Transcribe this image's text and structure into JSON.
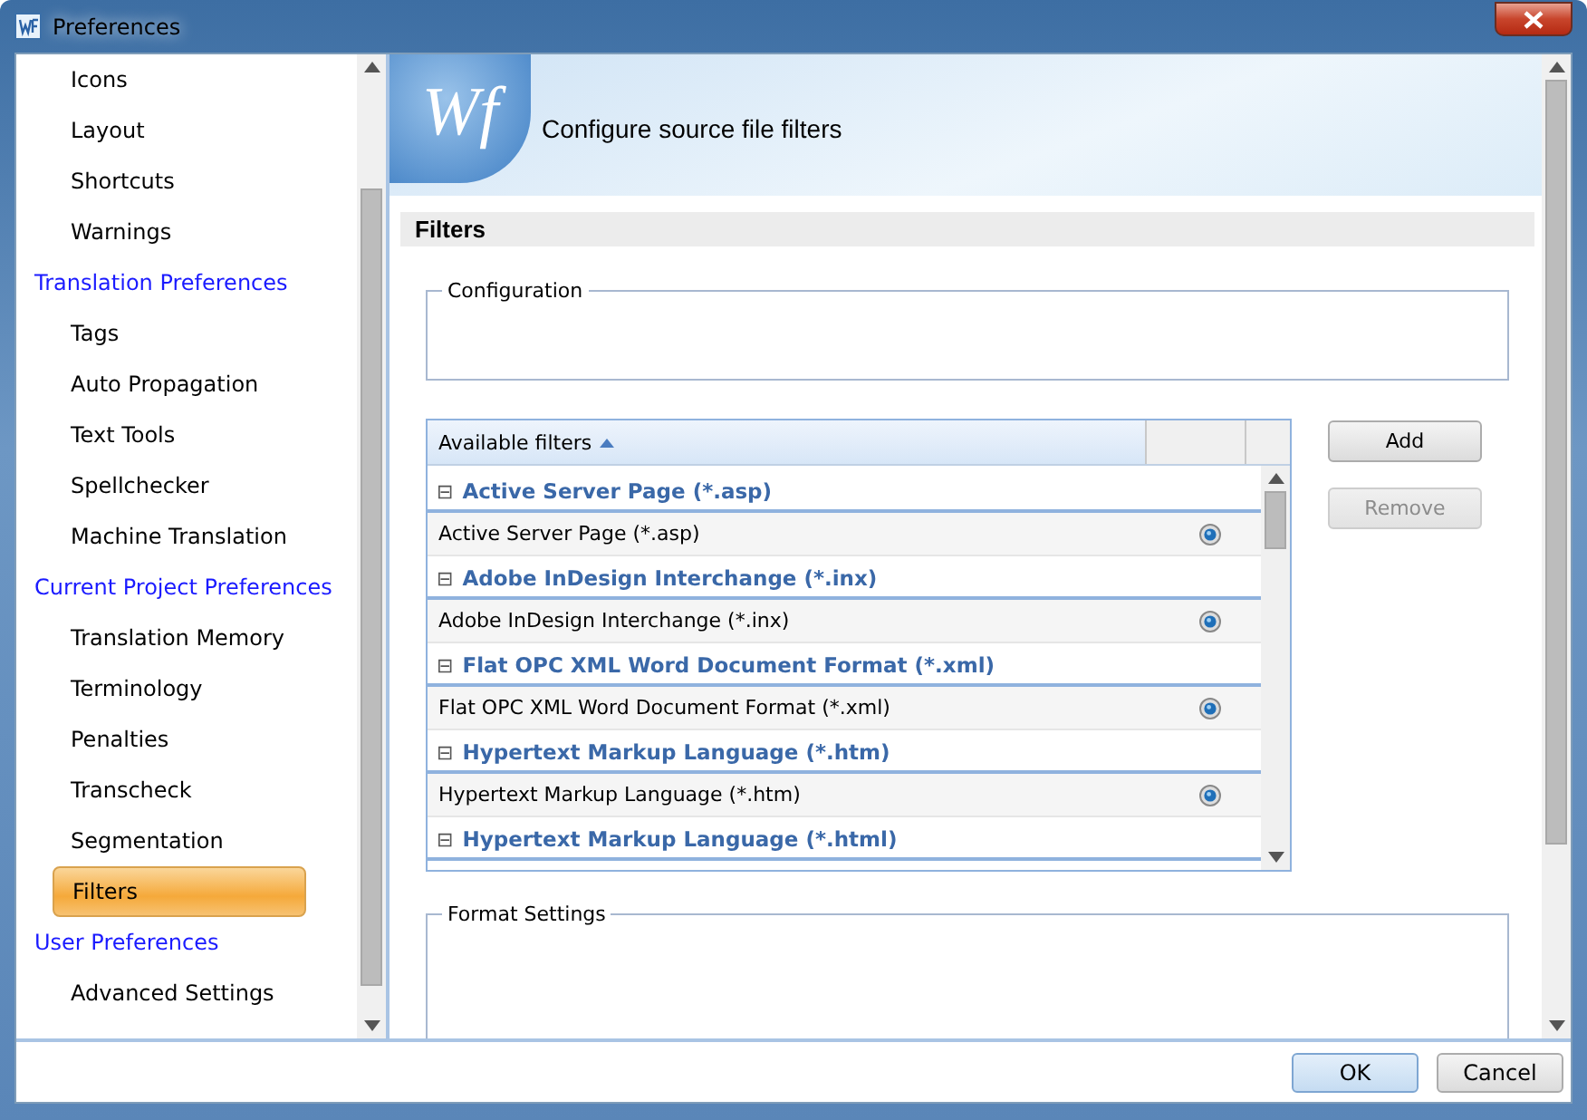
{
  "window": {
    "title": "Preferences"
  },
  "sidebar": {
    "items": [
      {
        "label": "Icons",
        "kind": "item",
        "selected": false
      },
      {
        "label": "Layout",
        "kind": "item",
        "selected": false
      },
      {
        "label": "Shortcuts",
        "kind": "item",
        "selected": false
      },
      {
        "label": "Warnings",
        "kind": "item",
        "selected": false
      },
      {
        "label": "Translation Preferences",
        "kind": "category",
        "selected": false
      },
      {
        "label": "Tags",
        "kind": "item",
        "selected": false
      },
      {
        "label": "Auto Propagation",
        "kind": "item",
        "selected": false
      },
      {
        "label": "Text Tools",
        "kind": "item",
        "selected": false
      },
      {
        "label": "Spellchecker",
        "kind": "item",
        "selected": false
      },
      {
        "label": "Machine Translation",
        "kind": "item",
        "selected": false
      },
      {
        "label": "Current Project Preferences",
        "kind": "category",
        "selected": false
      },
      {
        "label": "Translation Memory",
        "kind": "item",
        "selected": false
      },
      {
        "label": "Terminology",
        "kind": "item",
        "selected": false
      },
      {
        "label": "Penalties",
        "kind": "item",
        "selected": false
      },
      {
        "label": "Transcheck",
        "kind": "item",
        "selected": false
      },
      {
        "label": "Segmentation",
        "kind": "item",
        "selected": false
      },
      {
        "label": "Filters",
        "kind": "item",
        "selected": true
      },
      {
        "label": "User Preferences",
        "kind": "category",
        "selected": false
      },
      {
        "label": "Advanced Settings",
        "kind": "item",
        "selected": false
      }
    ]
  },
  "banner": {
    "logo": "Wf",
    "title": "Configure source file filters"
  },
  "section": {
    "title": "Filters"
  },
  "configuration": {
    "legend": "Configuration"
  },
  "filters_grid": {
    "column": "Available filters",
    "groups": [
      {
        "header": "Active Server Page (*.asp)",
        "expand_icon": "⊟",
        "rows": [
          "Active Server Page (*.asp)"
        ]
      },
      {
        "header": "Adobe InDesign Interchange (*.inx)",
        "expand_icon": "⊟",
        "rows": [
          "Adobe InDesign Interchange (*.inx)"
        ]
      },
      {
        "header": "Flat OPC XML Word Document Format (*.xml)",
        "expand_icon": "⊟",
        "rows": [
          "Flat OPC XML Word Document Format (*.xml)"
        ]
      },
      {
        "header": "Hypertext Markup Language (*.htm)",
        "expand_icon": "⊟",
        "rows": [
          "Hypertext Markup Language (*.htm)"
        ]
      },
      {
        "header": "Hypertext Markup Language (*.html)",
        "expand_icon": "⊟"
      }
    ]
  },
  "side_buttons": [
    {
      "label": "Add",
      "disabled": false
    },
    {
      "label": "Remove",
      "disabled": true
    }
  ],
  "format_settings": {
    "legend": "Format Settings"
  },
  "dialog_buttons": [
    {
      "label": "OK",
      "default": true
    },
    {
      "label": "Cancel",
      "default": false
    }
  ]
}
